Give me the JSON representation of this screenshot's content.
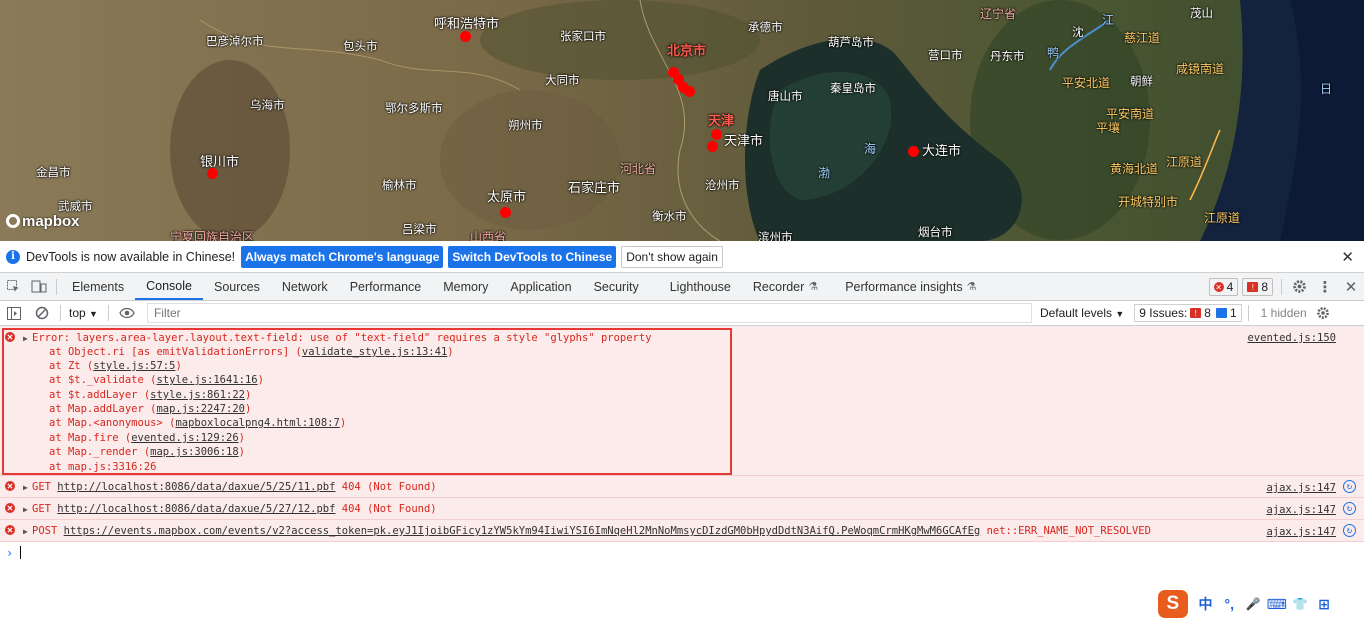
{
  "map": {
    "labels": {
      "baotou_shi": "包头市",
      "bayannur_shi": "巴彦淖尔市",
      "hohhot_shi": "呼和浩特市",
      "zhangjiakou_shi": "张家口市",
      "chengde_shi": "承德市",
      "chifeng_shi": "葫芦岛市",
      "yingkou_shi": "营口市",
      "liaoning_sheng": "辽宁省",
      "wuhai_shi": "乌海市",
      "ordos_shi": "鄂尔多斯市",
      "datong_shi": "大同市",
      "beijing_shi": "北京市",
      "tangshan_shi": "唐山市",
      "qinhuangdao_shi": "秦皇岛市",
      "shuozhou_shi": "朔州市",
      "tianjin_label": "天津",
      "tianjin_shi": "天津市",
      "yinchuan_shi": "银川市",
      "shizuishan_shi": "金昌市",
      "wuzhong_shi": "武威市",
      "yulin_shi": "榆林市",
      "taiyuan_shi": "太原市",
      "shijiazhuang_shi": "石家庄市",
      "hebei_sheng": "河北省",
      "cangzhou_shi": "沧州市",
      "hengshui_shi": "衡水市",
      "luliang_shi": "吕梁市",
      "shanxi_sheng": "山西省",
      "ningxia": "宁夏回族自治区",
      "binzhou_shi": "滨州市",
      "yantai_shi": "烟台市",
      "dalian_shi": "大连市",
      "bohai_1": "渤",
      "bohai_2": "海",
      "korea_1": "慈江道",
      "korea_2": "咸镜南道",
      "korea_3": "平安北道",
      "korea_4": "平安南道",
      "korea_5": "平壤",
      "korea_6": "黄海北道",
      "korea_7": "江原道",
      "korea_8": "开城特别市",
      "korea_9": "江原道",
      "korea_10": "朝鲜",
      "korea_11": "鸭",
      "korea_12": "江",
      "korea_13": "沈",
      "korea_14": "茂山",
      "korea_15": "丹东市",
      "korea_16": "日"
    },
    "logo_text": "mapbox"
  },
  "infobar": {
    "text": "DevTools is now available in Chinese!",
    "btn_match": "Always match Chrome's language",
    "btn_switch": "Switch DevTools to Chinese",
    "btn_dismiss": "Don't show again",
    "close": "✕"
  },
  "tabs": {
    "items": [
      "Elements",
      "Console",
      "Sources",
      "Network",
      "Performance",
      "Memory",
      "Application",
      "Security",
      "Lighthouse",
      "Recorder",
      "Performance insights"
    ],
    "active": "Console",
    "error_count": "4",
    "warn_count": "8"
  },
  "toolbar": {
    "context": "top",
    "filter_placeholder": "Filter",
    "levels": "Default levels",
    "issues_label": "9 Issues:",
    "issues_errors": "8",
    "issues_info": "1",
    "hidden": "1 hidden"
  },
  "console": {
    "error1": {
      "message": "Error: layers.area-layer.layout.text-field: use of \"text-field\" requires a style \"glyphs\" property",
      "source": "evented.js:150",
      "stack": [
        {
          "prefix": "at Object.ri [as emitValidationErrors] (",
          "link": "validate_style.js:13:41",
          "suffix": ")"
        },
        {
          "prefix": "at Zt (",
          "link": "style.js:57:5",
          "suffix": ")"
        },
        {
          "prefix": "at $t._validate (",
          "link": "style.js:1641:16",
          "suffix": ")"
        },
        {
          "prefix": "at $t.addLayer (",
          "link": "style.js:861:22",
          "suffix": ")"
        },
        {
          "prefix": "at Map.addLayer (",
          "link": "map.js:2247:20",
          "suffix": ")"
        },
        {
          "prefix": "at Map.<anonymous> (",
          "link": "mapboxlocalpng4.html:108:7",
          "suffix": ")"
        },
        {
          "prefix": "at Map.fire (",
          "link": "evented.js:129:26",
          "suffix": ")"
        },
        {
          "prefix": "at Map._render (",
          "link": "map.js:3006:18",
          "suffix": ")"
        },
        {
          "prefix": "at ",
          "link": "map.js:3316:26",
          "suffix": ""
        }
      ]
    },
    "requests": [
      {
        "method": "GET",
        "url": "http://localhost:8086/data/daxue/5/25/11.pbf",
        "status": "404 (Not Found)",
        "source": "ajax.js:147"
      },
      {
        "method": "GET",
        "url": "http://localhost:8086/data/daxue/5/27/12.pbf",
        "status": "404 (Not Found)",
        "source": "ajax.js:147"
      },
      {
        "method": "POST",
        "url": "https://events.mapbox.com/events/v2?access_token=pk.eyJ1IjoibGFicy1zYW5kYm94IiwiYSI6ImNqeHl2MnNoMmsycDIzdGM0bHpydDdtN3AifQ.PeWoqmCrmHKgMwM6GCAfEg",
        "status": "net::ERR_NAME_NOT_RESOLVED",
        "source": "ajax.js:147"
      }
    ],
    "prompt": "›"
  },
  "ime": {
    "logo": "S",
    "items": [
      "中",
      "°,",
      "🎤",
      "⌨",
      "👕",
      "⊞"
    ]
  }
}
